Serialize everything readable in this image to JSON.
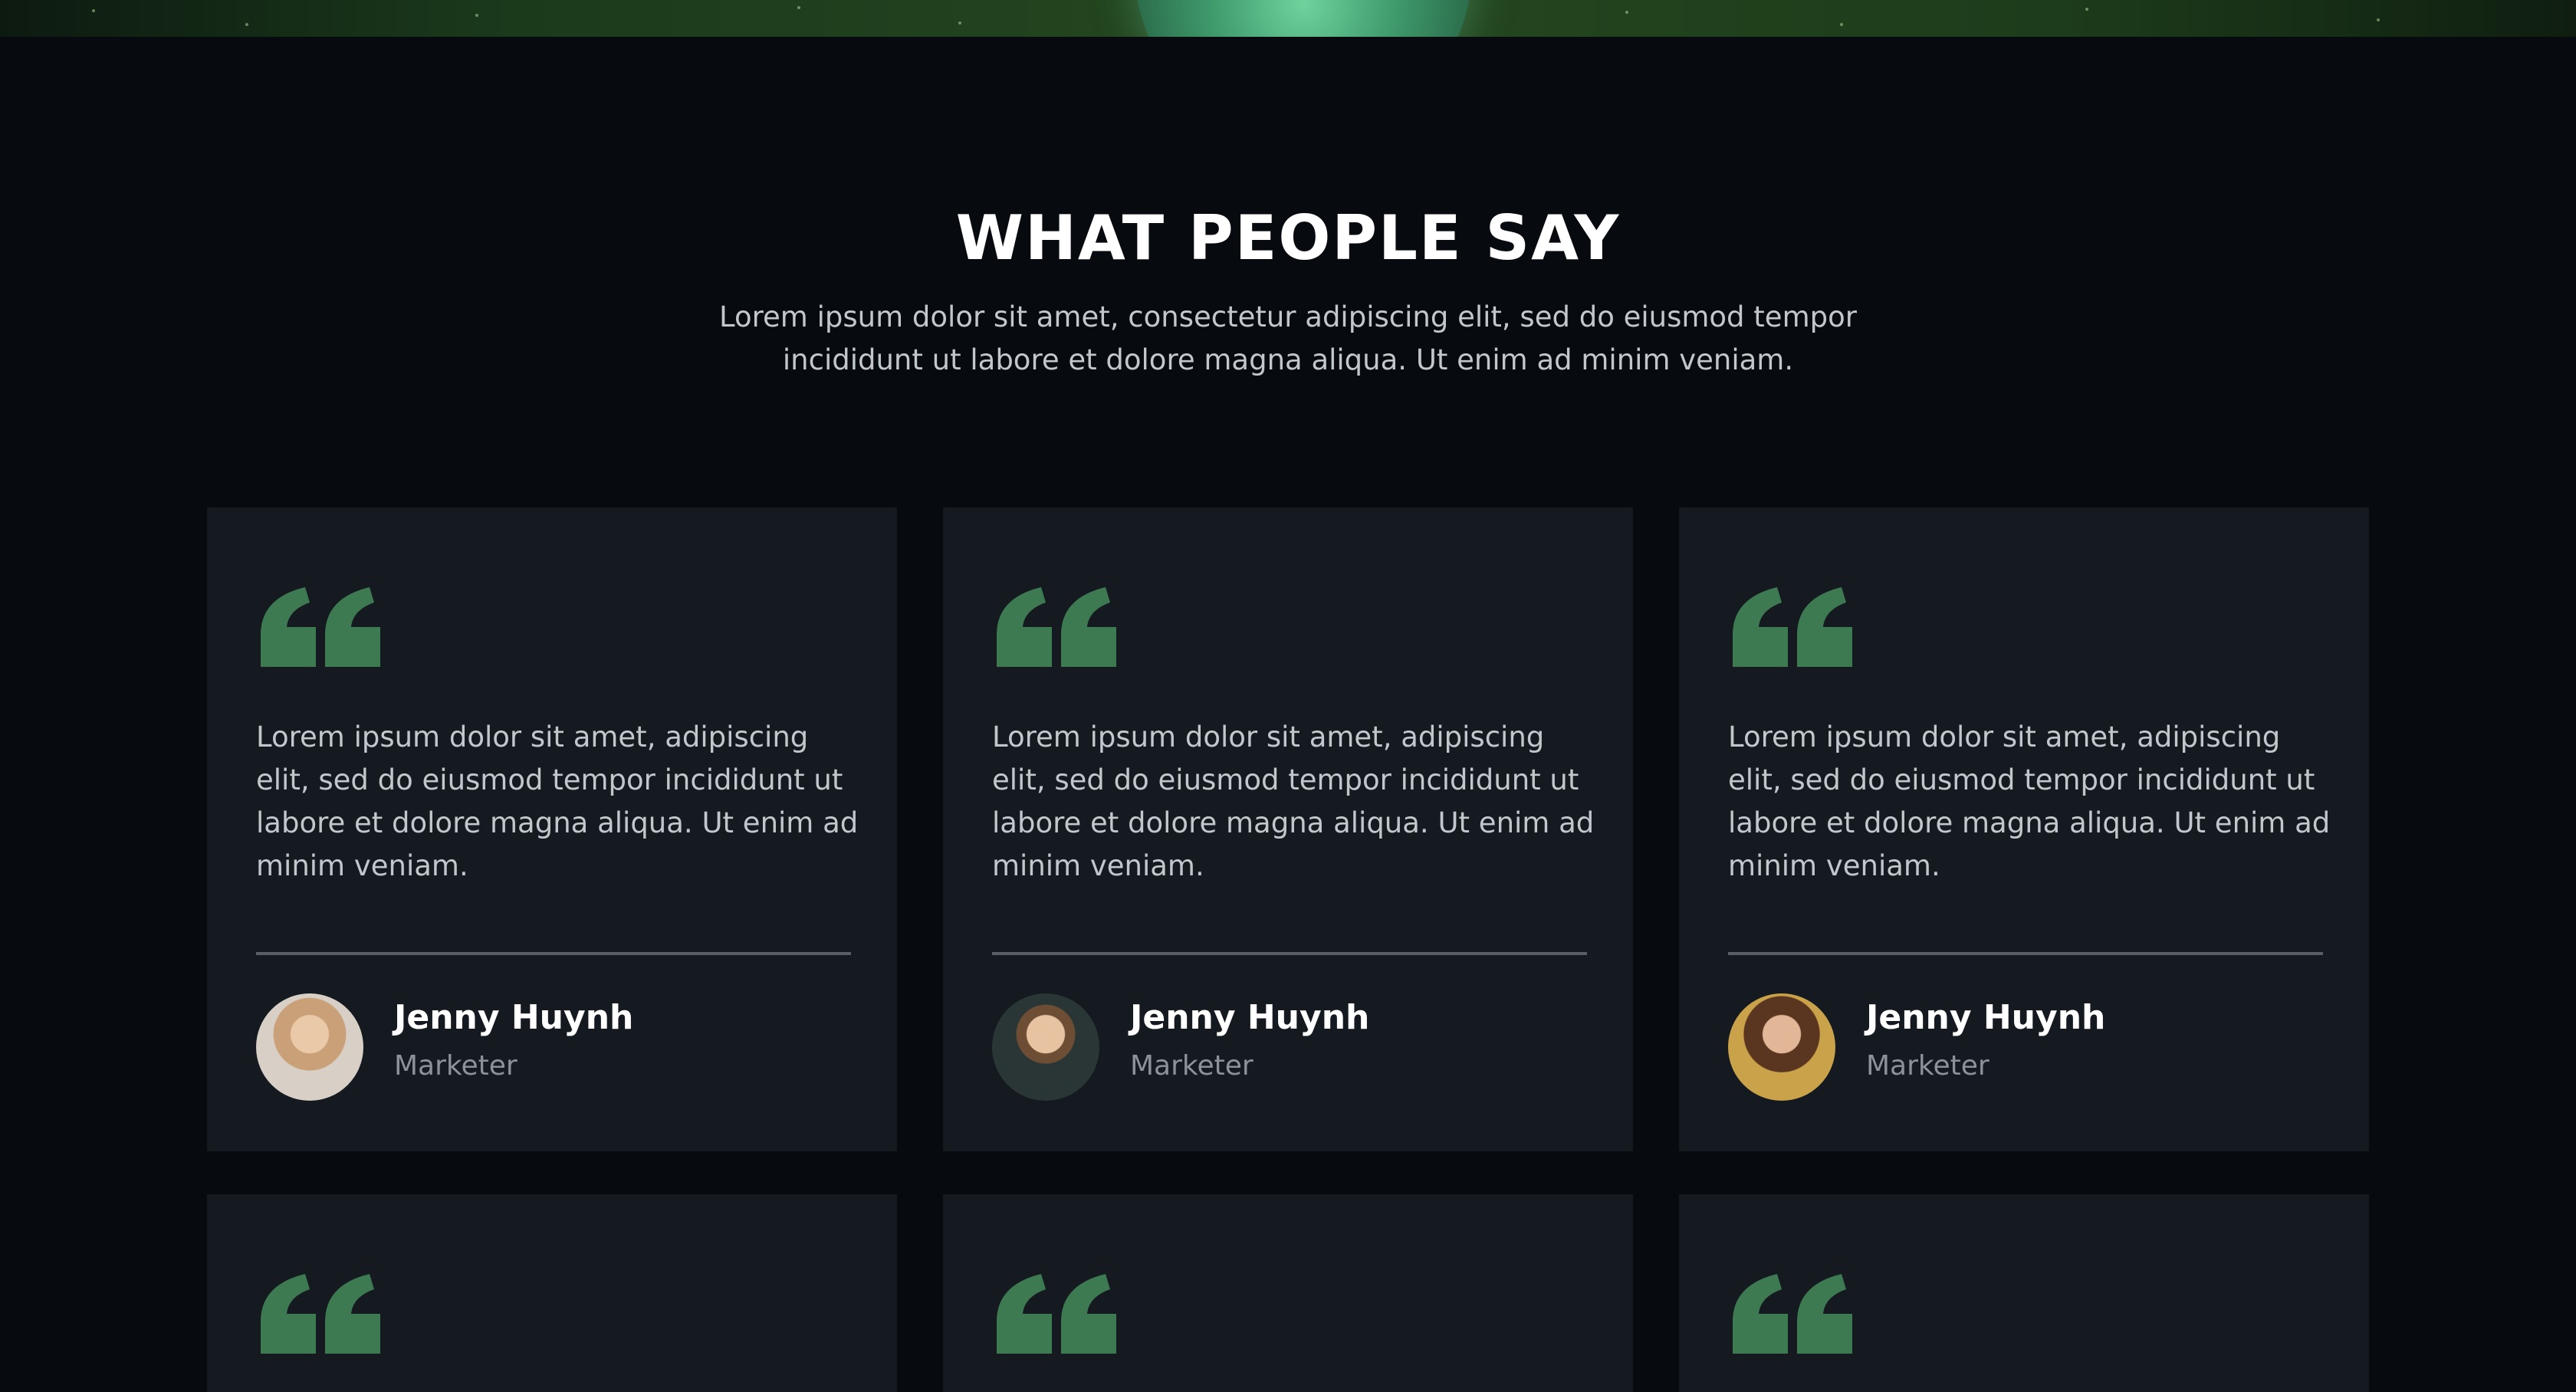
{
  "section": {
    "title": "WHAT PEOPLE SAY",
    "subtitle": "Lorem ipsum dolor sit amet, consectetur adipiscing elit, sed do eiusmod tempor incididunt ut labore et dolore magna aliqua. Ut enim ad minim veniam."
  },
  "colors": {
    "background": "#070b10",
    "card": "#151a21",
    "accent": "#3d7a52",
    "text": "#c2c7cc",
    "muted": "#8d9298"
  },
  "testimonials": [
    {
      "quote": "Lorem ipsum dolor sit amet, adipiscing elit, sed do eiusmod tempor incididunt ut labore et dolore magna aliqua. Ut enim ad minim veniam.",
      "name": "Jenny Huynh",
      "role": "Marketer",
      "icon": "quote-icon"
    },
    {
      "quote": "Lorem ipsum dolor sit amet, adipiscing elit, sed do eiusmod tempor incididunt ut labore et dolore magna aliqua. Ut enim ad minim veniam.",
      "name": "Jenny Huynh",
      "role": "Marketer",
      "icon": "quote-icon"
    },
    {
      "quote": "Lorem ipsum dolor sit amet, adipiscing elit, sed do eiusmod tempor incididunt ut labore et dolore magna aliqua. Ut enim ad minim veniam.",
      "name": "Jenny Huynh",
      "role": "Marketer",
      "icon": "quote-icon"
    }
  ]
}
